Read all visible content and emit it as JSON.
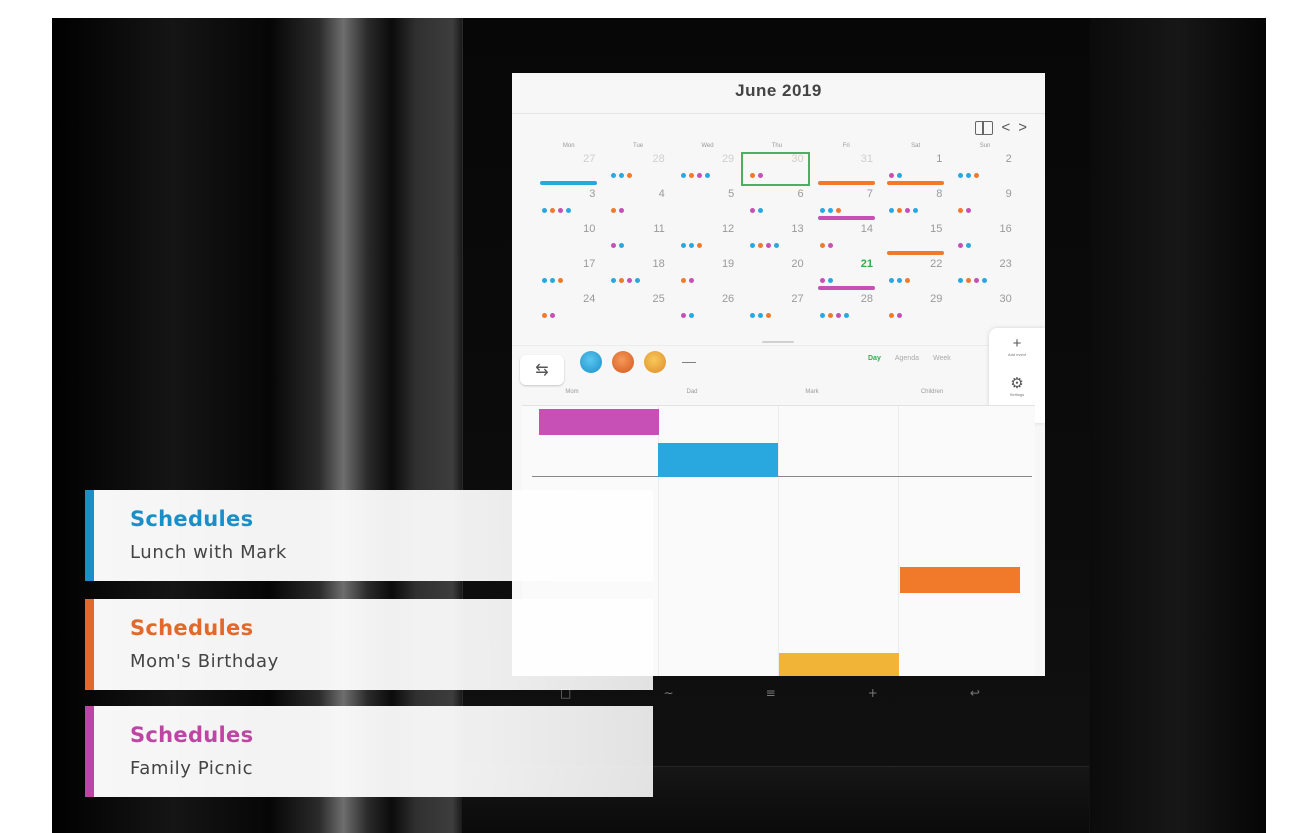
{
  "calendar": {
    "month_title": "June 2019",
    "nav_prev": "<",
    "nav_next": ">",
    "weekdays": [
      "Mon",
      "Tue",
      "Wed",
      "Thu",
      "Fri",
      "Sat",
      "Sun"
    ],
    "weeks": [
      [
        "27",
        "28",
        "29",
        "30",
        "31",
        "1",
        "2"
      ],
      [
        "3",
        "4",
        "5",
        "6",
        "7",
        "8",
        "9"
      ],
      [
        "10",
        "11",
        "12",
        "13",
        "14",
        "15",
        "16"
      ],
      [
        "17",
        "18",
        "19",
        "20",
        "21",
        "22",
        "23"
      ],
      [
        "24",
        "25",
        "26",
        "27",
        "28",
        "29",
        "30"
      ]
    ],
    "today": "21",
    "selected": "30",
    "view_tabs": [
      "Day",
      "Agenda",
      "Week"
    ],
    "active_tab": "Day",
    "members": [
      "Mom",
      "Dad",
      "Mark",
      "Children"
    ],
    "back_icon": "back-arrow-icon",
    "tools": [
      {
        "icon": "plus-icon",
        "label": "Add event"
      },
      {
        "icon": "gear-icon",
        "label": "Settings"
      }
    ]
  },
  "labels": [
    {
      "title": "Schedules",
      "subtitle": "Lunch with Mark",
      "color": "#1a8fc7"
    },
    {
      "title": "Schedules",
      "subtitle": "Mom's Birthday",
      "color": "#e2692a"
    },
    {
      "title": "Schedules",
      "subtitle": "Family Picnic",
      "color": "#bd46a4"
    }
  ],
  "colors": {
    "pink": "#c650b5",
    "blue": "#28a8df",
    "orange": "#f0792a",
    "yellow": "#f2b436",
    "green": "#2fae4e"
  }
}
